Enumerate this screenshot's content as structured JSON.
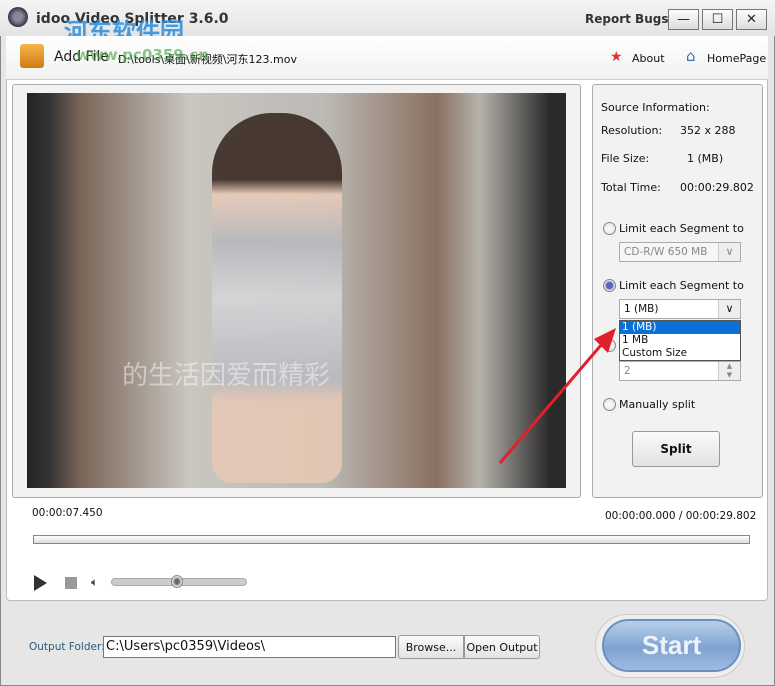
{
  "window": {
    "title": "idoo Video Splitter 3.6.0",
    "report_bugs": "Report Bugs",
    "minimize": "—",
    "maximize": "☐",
    "close": "✕"
  },
  "watermark": {
    "cn": "河东软件园",
    "url": "www.pc0359.cn"
  },
  "toolbar": {
    "add_file": "Add File",
    "file_path": "D:\\tools\\桌面\\新视频\\河东123.mov",
    "about": "About",
    "homepage": "HomePage"
  },
  "source": {
    "heading": "Source Information:",
    "resolution_label": "Resolution:",
    "resolution": "352 x 288",
    "filesize_label": "File Size:",
    "filesize": "1 (MB)",
    "total_label": "Total Time:",
    "total": "00:00:29.802"
  },
  "options": {
    "opt1_label": "Limit each Segment to",
    "opt1_value": "CD-R/W 650 MB",
    "opt2_label": "Limit each Segment to",
    "opt2_value": "1 (MB)",
    "dropdown_options": [
      "1 (MB)",
      "1 MB",
      "Custom Size"
    ],
    "opt3_value": "2",
    "opt4_label": "Manually split",
    "split": "Split"
  },
  "video": {
    "subtitle": "的生活因爱而精彩"
  },
  "player": {
    "current": "00:00:07.450",
    "position": "00:00:00.000 / 00:00:29.802",
    "volume": 0.5
  },
  "output": {
    "label": "Output Folder:",
    "path": "C:\\Users\\pc0359\\Videos\\",
    "browse": "Browse...",
    "open": "Open Output",
    "start": "Start"
  },
  "colors": {
    "accent": "#1a6fcf",
    "arrow": "#e0202a"
  }
}
